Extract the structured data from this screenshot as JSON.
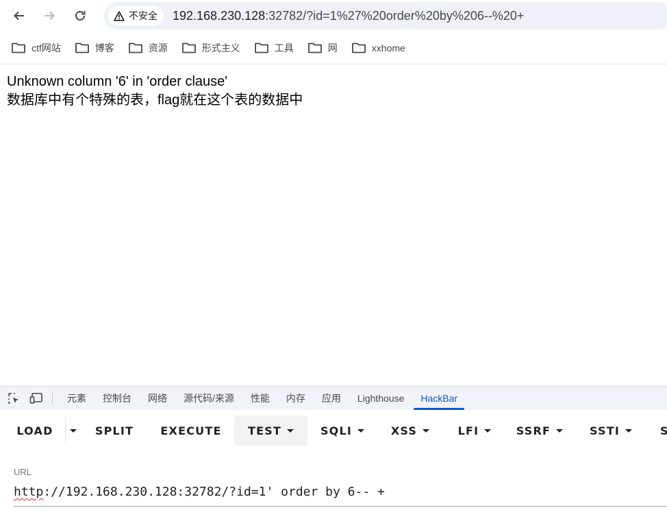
{
  "browser": {
    "security_label": "不安全",
    "address": {
      "host": "192.168.230.128",
      "path": ":32782/?id=1%27%20order%20by%206--%20+"
    },
    "bookmarks": [
      "ctf网站",
      "博客",
      "资源",
      "形式主义",
      "工具",
      "网",
      "xxhome"
    ]
  },
  "page": {
    "error_line": "Unknown column '6' in 'order clause'",
    "hint_line": "数据库中有个特殊的表，flag就在这个表的数据中"
  },
  "devtools": {
    "tabs": [
      "元素",
      "控制台",
      "网络",
      "源代码/来源",
      "性能",
      "内存",
      "应用",
      "Lighthouse",
      "HackBar"
    ],
    "active_tab": "HackBar",
    "accent_color": "#0b57d0"
  },
  "hackbar": {
    "buttons": {
      "load": "LOAD",
      "split": "SPLIT",
      "execute": "EXECUTE",
      "test": "TEST",
      "sqli": "SQLI",
      "xss": "XSS",
      "lfi": "LFI",
      "ssrf": "SSRF",
      "ssti": "SSTI",
      "more": "S"
    },
    "url_label": "URL",
    "url_value": {
      "scheme": "http",
      "rest": "://192.168.230.128:32782/?id=1' order by 6-- +"
    }
  }
}
